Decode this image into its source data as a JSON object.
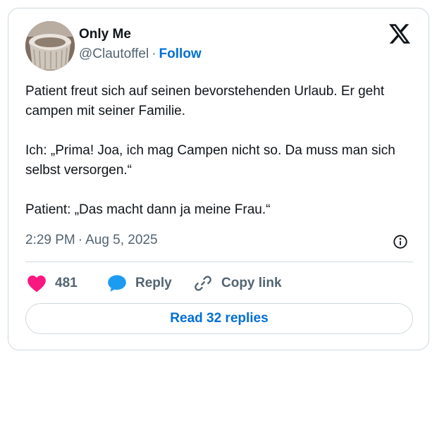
{
  "author": {
    "name": "Only Me",
    "handle": "@Clautoffel",
    "separator": "·",
    "follow_label": "Follow"
  },
  "logo": {
    "icon": "x-logo-icon"
  },
  "tweet": {
    "text": "Patient freut sich auf seinen bevorstehenden Urlaub. Er geht campen mit seiner Familie.\n\nIch: „Prima! Joa, ich mag Campen nicht so. Da muss man sich selbst versorgen.“\n\nPatient: „Das macht dann ja meine Frau.“",
    "time": "2:29 PM",
    "separator": "·",
    "date": "Aug 5, 2025"
  },
  "actions": {
    "like_count": "481",
    "reply_label": "Reply",
    "copy_label": "Copy link"
  },
  "read_replies_label": "Read 32 replies",
  "colors": {
    "like": "#f91880",
    "reply": "#1d9bf0",
    "link": "#006fd6",
    "muted": "#536471",
    "border": "#cfd9de"
  }
}
